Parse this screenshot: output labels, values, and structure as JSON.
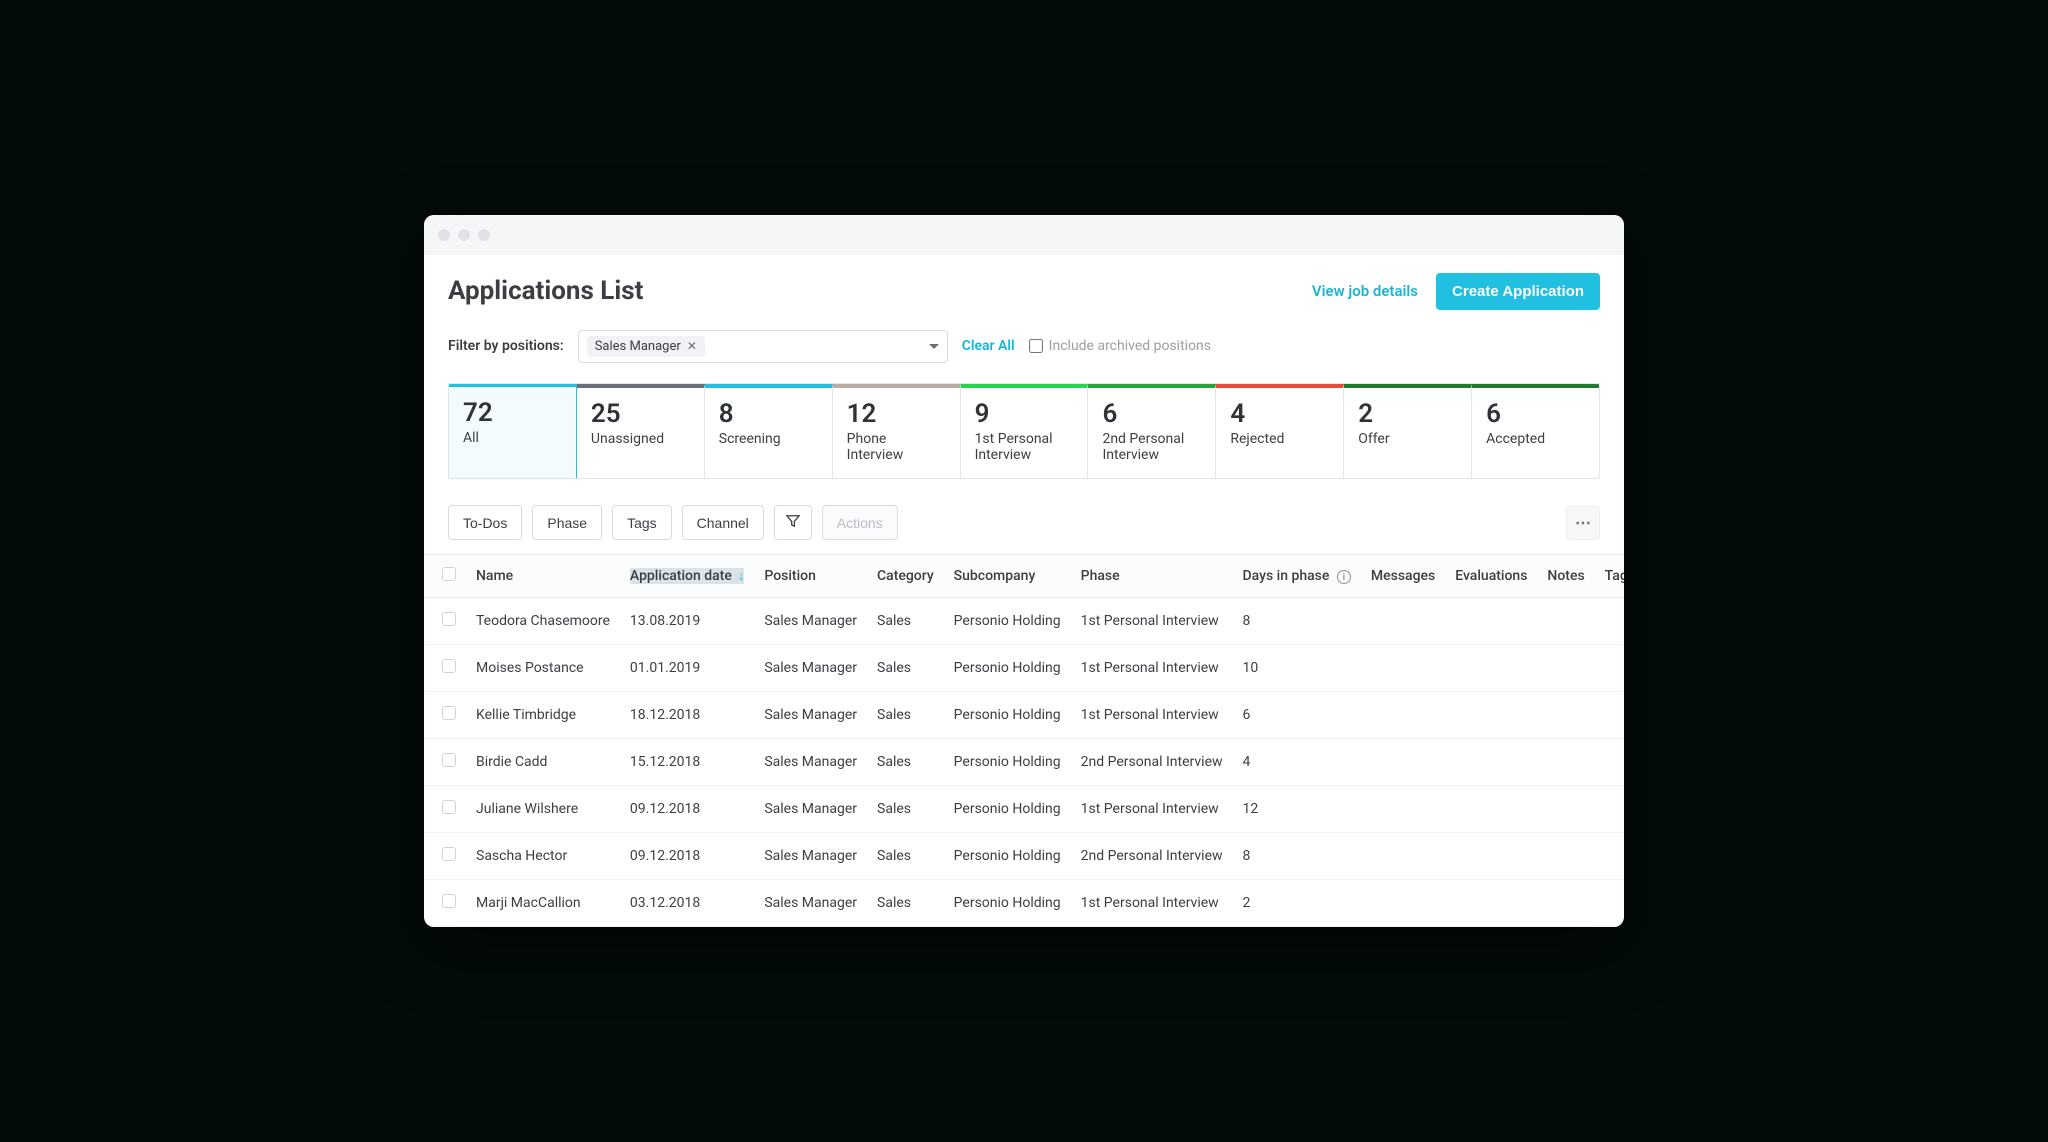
{
  "header": {
    "title": "Applications List",
    "view_details": "View job details",
    "create_button": "Create Application"
  },
  "filter": {
    "label": "Filter by positions:",
    "chip": "Sales Manager",
    "clear_all": "Clear All",
    "archived_label": "Include archived positions"
  },
  "stages": [
    {
      "count": "72",
      "label": "All",
      "color": "#21bfe0",
      "active": true
    },
    {
      "count": "25",
      "label": "Unassigned",
      "color": "#6a6f76"
    },
    {
      "count": "8",
      "label": "Screening",
      "color": "#21bfe0"
    },
    {
      "count": "12",
      "label": "Phone Interview",
      "color": "#b9ada2"
    },
    {
      "count": "9",
      "label": "1st Personal Interview",
      "color": "#24d649"
    },
    {
      "count": "6",
      "label": "2nd Personal Interview",
      "color": "#23a53a"
    },
    {
      "count": "4",
      "label": "Rejected",
      "color": "#e84b3a"
    },
    {
      "count": "2",
      "label": "Offer",
      "color": "#1f7c2c"
    },
    {
      "count": "6",
      "label": "Accepted",
      "color": "#1f7c2c"
    }
  ],
  "filter_buttons": {
    "todos": "To-Dos",
    "phase": "Phase",
    "tags": "Tags",
    "channel": "Channel",
    "actions": "Actions"
  },
  "columns": {
    "name": "Name",
    "app_date": "Application date",
    "position": "Position",
    "category": "Category",
    "subcompany": "Subcompany",
    "phase": "Phase",
    "days": "Days in phase",
    "messages": "Messages",
    "evaluations": "Evaluations",
    "notes": "Notes",
    "tags": "Tags"
  },
  "rows": [
    {
      "name": "Teodora Chasemoore",
      "date": "13.08.2019",
      "position": "Sales Manager",
      "category": "Sales",
      "subcompany": "Personio Holding",
      "phase": "1st Personal Interview",
      "days": "8"
    },
    {
      "name": "Moises Postance",
      "date": "01.01.2019",
      "position": "Sales Manager",
      "category": "Sales",
      "subcompany": "Personio Holding",
      "phase": "1st Personal Interview",
      "days": "10"
    },
    {
      "name": "Kellie Timbridge",
      "date": "18.12.2018",
      "position": "Sales Manager",
      "category": "Sales",
      "subcompany": "Personio Holding",
      "phase": "1st Personal Interview",
      "days": "6"
    },
    {
      "name": "Birdie Cadd",
      "date": "15.12.2018",
      "position": "Sales Manager",
      "category": "Sales",
      "subcompany": "Personio Holding",
      "phase": "2nd Personal Interview",
      "days": "4"
    },
    {
      "name": "Juliane Wilshere",
      "date": "09.12.2018",
      "position": "Sales Manager",
      "category": "Sales",
      "subcompany": "Personio Holding",
      "phase": "1st Personal Interview",
      "days": "12"
    },
    {
      "name": "Sascha Hector",
      "date": "09.12.2018",
      "position": "Sales Manager",
      "category": "Sales",
      "subcompany": "Personio Holding",
      "phase": "2nd Personal Interview",
      "days": "8"
    },
    {
      "name": "Marji MacCallion",
      "date": "03.12.2018",
      "position": "Sales Manager",
      "category": "Sales",
      "subcompany": "Personio Holding",
      "phase": "1st Personal Interview",
      "days": "2"
    }
  ]
}
